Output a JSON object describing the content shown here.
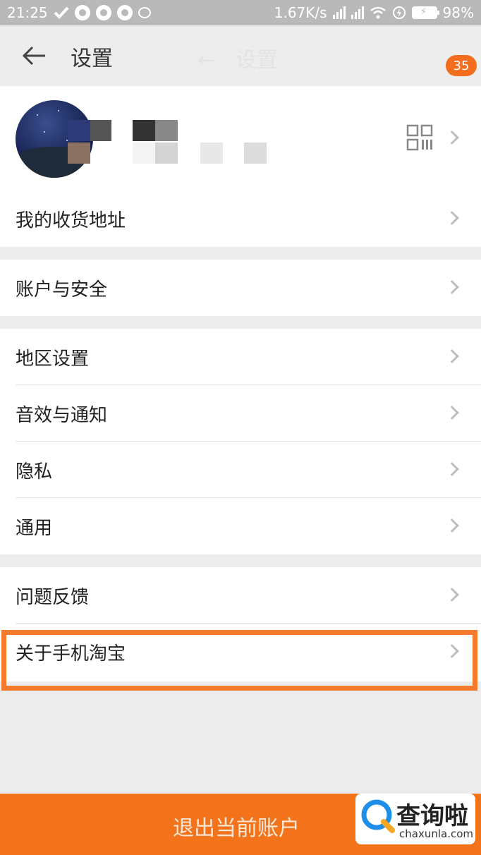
{
  "status_bar": {
    "time": "21:25",
    "network_speed": "1.67K/s",
    "battery": "98%"
  },
  "header": {
    "title": "设置",
    "ghost_title": "设置",
    "badge_count": "35"
  },
  "menu": {
    "group1": [
      {
        "label": "我的收货地址"
      }
    ],
    "group2": [
      {
        "label": "账户与安全"
      }
    ],
    "group3": [
      {
        "label": "地区设置"
      },
      {
        "label": "音效与通知"
      },
      {
        "label": "隐私"
      },
      {
        "label": "通用"
      }
    ],
    "group4": [
      {
        "label": "问题反馈"
      },
      {
        "label": "关于手机淘宝"
      }
    ]
  },
  "logout": {
    "label": "退出当前账户"
  },
  "watermark": {
    "title": "查询啦",
    "subtitle": "chaxunla.com"
  },
  "colors": {
    "accent": "#f3731a",
    "highlight": "#f47b2e",
    "badge": "#f46c1e"
  }
}
